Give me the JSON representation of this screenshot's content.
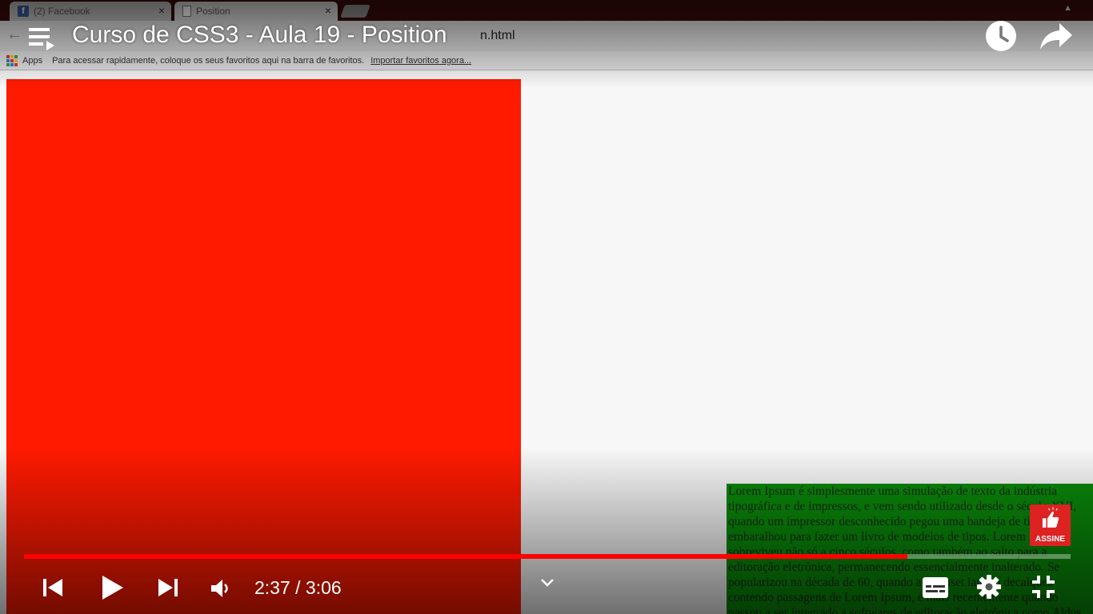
{
  "browser": {
    "tabs": [
      {
        "title": "(2) Facebook",
        "favicon": "facebook-icon",
        "active": false
      },
      {
        "title": "Position",
        "favicon": "document-icon",
        "active": true
      }
    ],
    "close_glyph": "×",
    "address_visible_fragment": "n.html",
    "bookmarks_bar": {
      "apps_label": "Apps",
      "hint": "Para acessar rapidamente, coloque os seus favoritos aqui na barra de favoritos.",
      "import_link": "Importar favoritos agora..."
    }
  },
  "page_content": {
    "red_box_color": "#ff1a00",
    "green_box_color": "#0a8a0a",
    "green_box_text": "Lorem Ipsum é simplesmente uma simulação de texto da indústria tipográfica e de impressos, e vem sendo utilizado desde o século XVI, quando um impressor desconhecido pegou uma bandeja de tipos e os embaralhou para fazer um livro de modelos de tipos. Lorem Ipsum sobreviveu não só a cinco séculos, como também ao salto para a editoração eletrônica, permanecendo essencialmente inalterado. Se popularizou na década de 60, quando a Letraset lançou decalques contendo passagens de Lorem Ipsum, e mais recentemente quando passou a ser integrado a softwares de editoração eletrônica como Aldus PageMaker."
  },
  "player": {
    "title": "Curso de CSS3 - Aula 19 - Position",
    "current_time": "2:37",
    "duration": "3:06",
    "time_display": "2:37 / 3:06",
    "progress_fraction": 0.844,
    "progress_color": "#ff0000",
    "subscribe_label": "ASSINE",
    "icons": {
      "playlist": "playlist-icon",
      "watch_later": "clock-icon",
      "share": "share-arrow-icon",
      "previous": "skip-previous-icon",
      "play": "play-icon",
      "next": "skip-next-icon",
      "volume": "volume-icon",
      "expand": "chevron-down-icon",
      "subtitles": "subtitles-icon",
      "settings": "gear-icon",
      "exit_fullscreen": "exit-fullscreen-icon",
      "subscribe": "thumbs-up-icon"
    }
  }
}
